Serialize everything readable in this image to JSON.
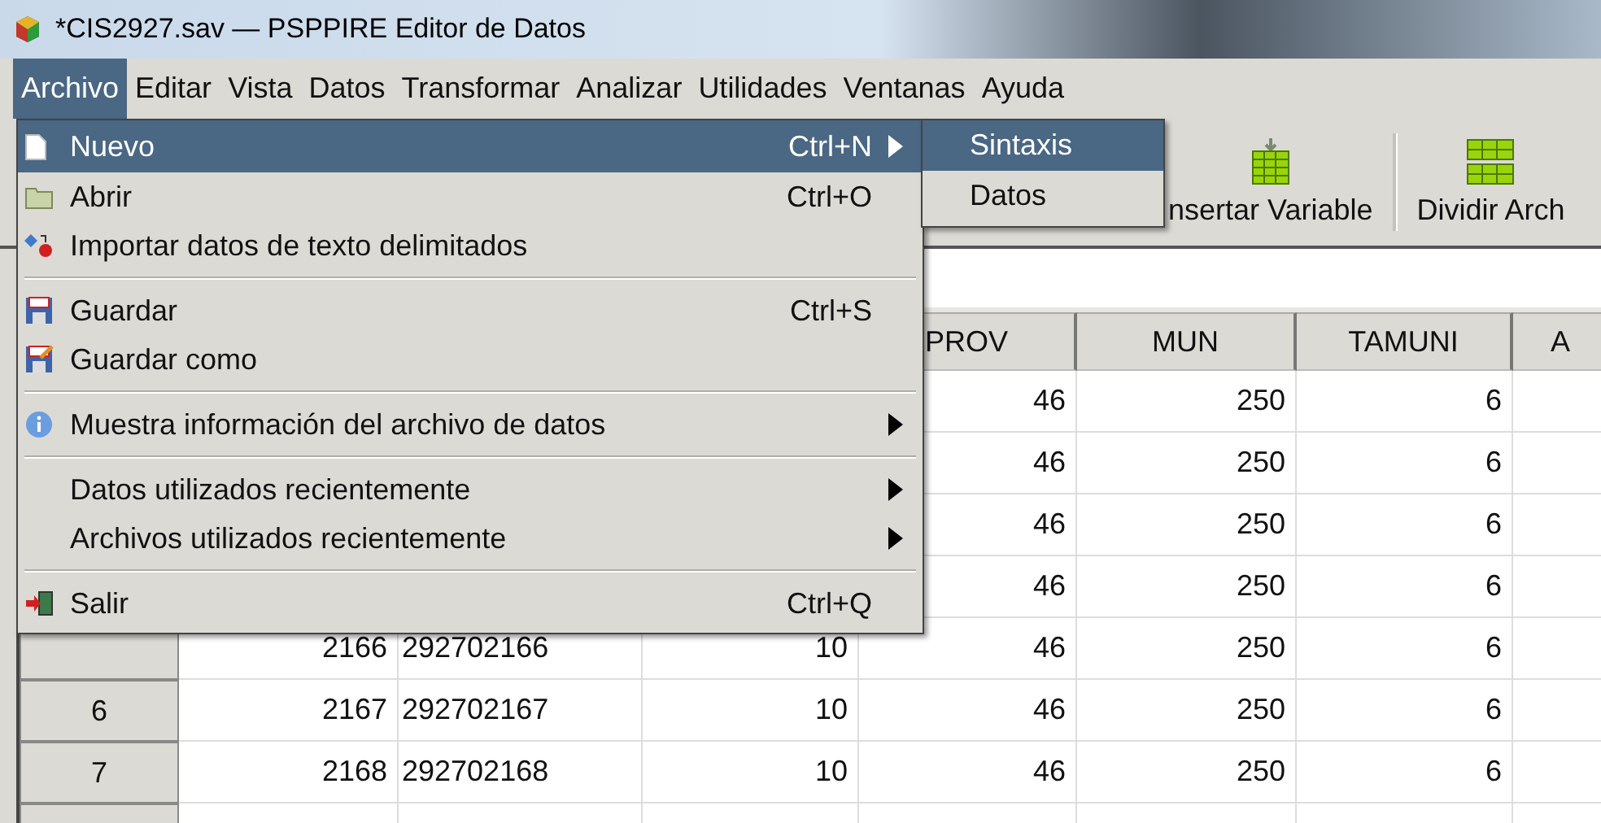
{
  "window": {
    "title": "*CIS2927.sav — PSPPIRE Editor de Datos"
  },
  "menubar": [
    {
      "label": "Archivo",
      "selected": true
    },
    {
      "label": "Editar",
      "selected": false
    },
    {
      "label": "Vista",
      "selected": false
    },
    {
      "label": "Datos",
      "selected": false
    },
    {
      "label": "Transformar",
      "selected": false
    },
    {
      "label": "Analizar",
      "selected": false
    },
    {
      "label": "Utilidades",
      "selected": false
    },
    {
      "label": "Ventanas",
      "selected": false
    },
    {
      "label": "Ayuda",
      "selected": false
    }
  ],
  "toolbar": {
    "buttons": [
      {
        "label": "nsertar Variable"
      },
      {
        "label": "Dividir Arch"
      }
    ]
  },
  "table": {
    "columns": [
      "PROV",
      "MUN",
      "TAMUNI",
      "A"
    ],
    "rows": [
      {
        "cells": [
          null,
          null,
          null,
          "46",
          "250",
          "6"
        ]
      },
      {
        "cells": [
          null,
          null,
          null,
          "46",
          "250",
          "6"
        ]
      },
      {
        "cells": [
          null,
          null,
          null,
          "46",
          "250",
          "6"
        ]
      },
      {
        "cells": [
          null,
          null,
          null,
          "46",
          "250",
          "6"
        ]
      },
      {
        "cells": [
          "2166",
          "292702166",
          "10",
          "46",
          "250",
          "6"
        ]
      },
      {
        "number": "6",
        "cells": [
          "2167",
          "292702167",
          "10",
          "46",
          "250",
          "6"
        ]
      },
      {
        "number": "7",
        "cells": [
          "2168",
          "292702168",
          "10",
          "46",
          "250",
          "6"
        ]
      }
    ]
  },
  "file_menu": {
    "items": [
      {
        "kind": "document",
        "label": "Nuevo",
        "shortcut": "Ctrl+N",
        "submenu": true,
        "selected": true
      },
      {
        "kind": "folder",
        "label": "Abrir",
        "shortcut": "Ctrl+O",
        "submenu": false,
        "selected": false
      },
      {
        "kind": "import",
        "label": "Importar datos de texto delimitados",
        "submenu": false,
        "selected": false
      },
      {
        "kind": "separator"
      },
      {
        "kind": "floppy",
        "label": "Guardar",
        "shortcut": "Ctrl+S",
        "submenu": false,
        "selected": false
      },
      {
        "kind": "floppy-edit",
        "label": "Guardar como",
        "submenu": false,
        "selected": false
      },
      {
        "kind": "separator"
      },
      {
        "kind": "info",
        "label": "Muestra información del archivo de datos",
        "submenu": true,
        "selected": false
      },
      {
        "kind": "separator"
      },
      {
        "kind": "plain",
        "label": "Datos utilizados recientemente",
        "submenu": true,
        "selected": false
      },
      {
        "kind": "plain",
        "label": "Archivos utilizados recientemente",
        "submenu": true,
        "selected": false
      },
      {
        "kind": "separator"
      },
      {
        "kind": "exit",
        "label": "Salir",
        "shortcut": "Ctrl+Q",
        "submenu": false,
        "selected": false
      }
    ]
  },
  "submenu": {
    "items": [
      {
        "label": "Sintaxis",
        "selected": true
      },
      {
        "label": "Datos",
        "selected": false
      }
    ]
  }
}
